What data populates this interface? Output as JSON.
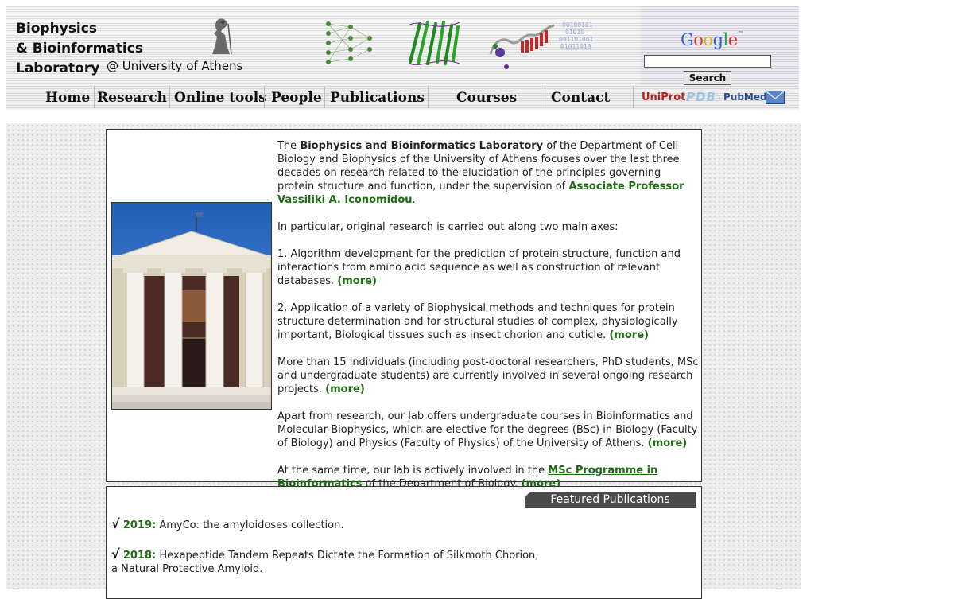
{
  "header": {
    "lab_title_line1": "Biophysics",
    "lab_title_line2": "& Bioinformatics",
    "lab_title_line3": "Laboratory",
    "lab_subtitle": "@ University of Athens",
    "fig3_bits": "00100101\n01010\n001101001\n01011010"
  },
  "search": {
    "logo_text": "Google",
    "placeholder": "",
    "button_label": "Search"
  },
  "nav": {
    "home": "Home",
    "research": "Research",
    "online_tools": "Online tools",
    "people": "People",
    "publications": "Publications",
    "courses": "Courses",
    "contact": "Contact",
    "uniprot": "UniProt",
    "pdb": "PDB",
    "pubmed": "PubMed"
  },
  "main": {
    "intro_pre": "The ",
    "intro_bold": "Biophysics and Bioinformatics Laboratory",
    "intro_mid": " of the Department of Cell Biology and Biophysics of the University of Athens focuses over the last three decades on research related to the elucidation of the principles governing protein structure and function, under the supervision of ",
    "intro_prof": "Associate Professor Vassiliki A. Iconomidou",
    "intro_end": ".",
    "axes_intro": "In particular, original research is carried out along two main axes:",
    "axis1": "1. Algorithm development for the prediction of protein structure, function and interactions from amino acid sequence as well as construction of relevant databases. ",
    "axis2": "2. Application of a variety of Biophysical methods and techniques for protein structure determination and for structural studies of complex, physiologically important, Biological tissues such as insect chorion and cuticle. ",
    "people": "More than 15 individuals (including post-doctoral researchers, PhD students, MSc and undergraduate students) are currently involved in several ongoing research projects. ",
    "courses": "Apart from research, our lab offers undergraduate courses in Bioinformatics and Molecular Biophysics, which are elective for the degrees (BSc) in Biology (Faculty of Biology) and Physics (Faculty of Physics) of the University of Athens. ",
    "msc_pre": "At the same time, our lab is actively involved in the ",
    "msc_link": "MSc Programme in Bioinformatics",
    "msc_post": " of the Department of Biology. ",
    "more": "(more)"
  },
  "featured": {
    "header": "Featured Publications",
    "check": "√",
    "items": [
      {
        "year": "2019:",
        "title": "AmyCo: the amyloidoses collection."
      },
      {
        "year": "2018:",
        "title": "Hexapeptide Tandem Repeats Dictate the Formation of Silkmoth Chorion, a Natural Protective Amyloid."
      }
    ]
  },
  "colors": {
    "accent_green": "#1d6b12",
    "featured_header_bg": "#4a4a4a"
  }
}
